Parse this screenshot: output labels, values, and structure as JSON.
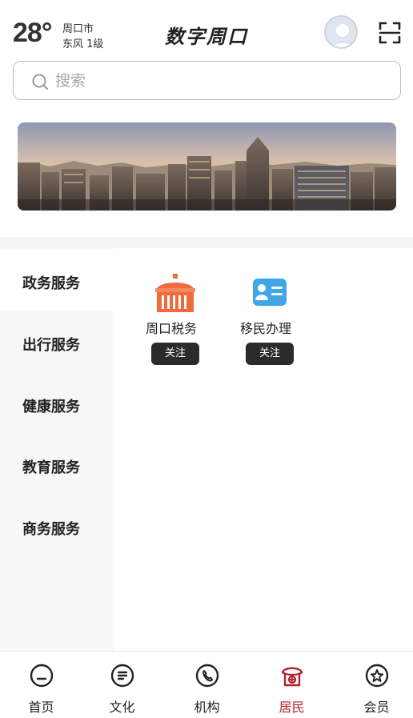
{
  "header": {
    "temperature": "28°",
    "city": "周口市",
    "wind": "东风 1级",
    "title": "数字周口"
  },
  "search": {
    "placeholder": "搜索"
  },
  "categories": [
    {
      "label": "政务服务",
      "active": true
    },
    {
      "label": "出行服务",
      "active": false
    },
    {
      "label": "健康服务",
      "active": false
    },
    {
      "label": "教育服务",
      "active": false
    },
    {
      "label": "商务服务",
      "active": false
    }
  ],
  "services": [
    {
      "label": "周口税务",
      "follow_label": "关注",
      "icon": "tax-bureau-icon"
    },
    {
      "label": "移民办理",
      "follow_label": "关注",
      "icon": "id-card-icon"
    }
  ],
  "bottom_nav": [
    {
      "label": "首页",
      "icon": "home-icon"
    },
    {
      "label": "文化",
      "icon": "document-icon"
    },
    {
      "label": "机构",
      "icon": "phone-icon"
    },
    {
      "label": "居民",
      "icon": "residents-icon",
      "active": true
    },
    {
      "label": "会员",
      "icon": "star-badge-icon"
    }
  ],
  "colors": {
    "accent": "#b3232c",
    "tax_orange": "#ef6a3c",
    "id_blue": "#3fa6e8",
    "follow_bg": "#2b2b2b"
  }
}
